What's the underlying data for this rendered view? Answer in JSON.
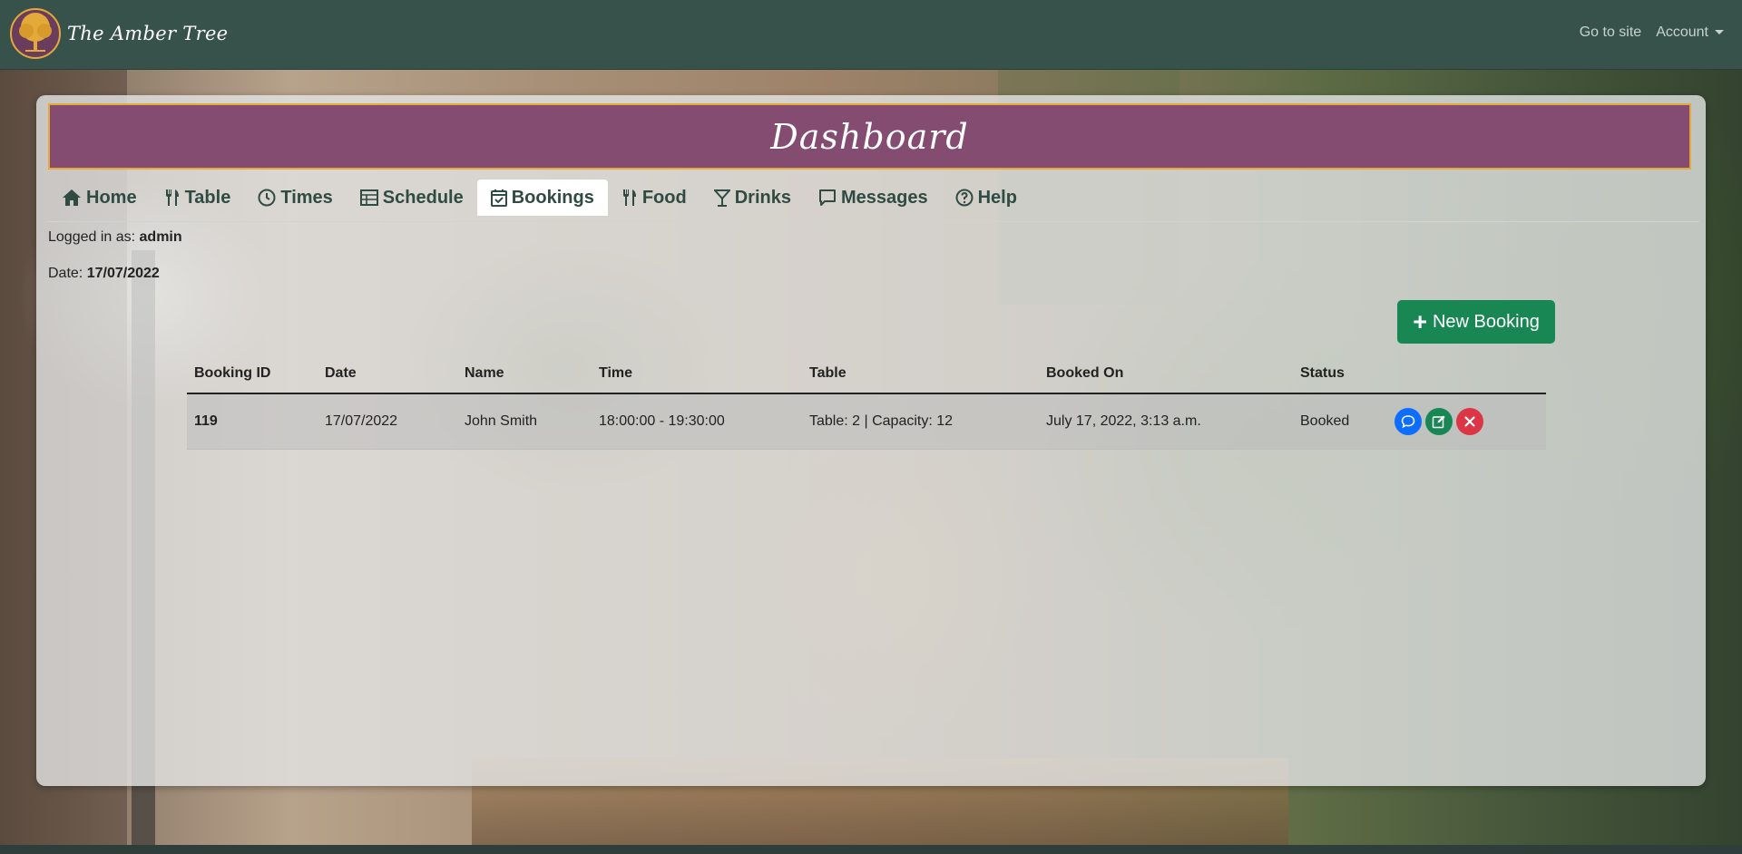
{
  "navbar": {
    "brand": "The Amber Tree",
    "links": {
      "site": "Go to site",
      "account": "Account"
    }
  },
  "header": {
    "title": "Dashboard"
  },
  "tabs": [
    {
      "label": "Home",
      "icon": "house-icon"
    },
    {
      "label": "Table",
      "icon": "fork-knife-icon"
    },
    {
      "label": "Times",
      "icon": "clock-icon"
    },
    {
      "label": "Schedule",
      "icon": "table-icon"
    },
    {
      "label": "Bookings",
      "icon": "calendar-check-icon",
      "active": true
    },
    {
      "label": "Food",
      "icon": "fork-knife-icon"
    },
    {
      "label": "Drinks",
      "icon": "cocktail-glass-icon"
    },
    {
      "label": "Messages",
      "icon": "chat-icon"
    },
    {
      "label": "Help",
      "icon": "question-circle-icon"
    }
  ],
  "session": {
    "logged_label": "Logged in as:",
    "user": "admin",
    "date_label": "Date:",
    "date": "17/07/2022"
  },
  "new_booking": {
    "label": "New Booking"
  },
  "table": {
    "columns": [
      "Booking ID",
      "Date",
      "Name",
      "Time",
      "Table",
      "Booked On",
      "Status"
    ],
    "rows": [
      {
        "id": "119",
        "date": "17/07/2022",
        "name": "John Smith",
        "time": "18:00:00 - 19:30:00",
        "table": "Table: 2 | Capacity: 12",
        "booked_on": "July 17, 2022, 3:13 a.m.",
        "status": "Booked"
      }
    ]
  },
  "colors": {
    "navbar": "#36524a",
    "header": "#854c72",
    "header_border": "#e3a93a",
    "tab_text": "#304b44",
    "success": "#198754",
    "primary": "#0d6efd",
    "danger": "#dc3545"
  }
}
